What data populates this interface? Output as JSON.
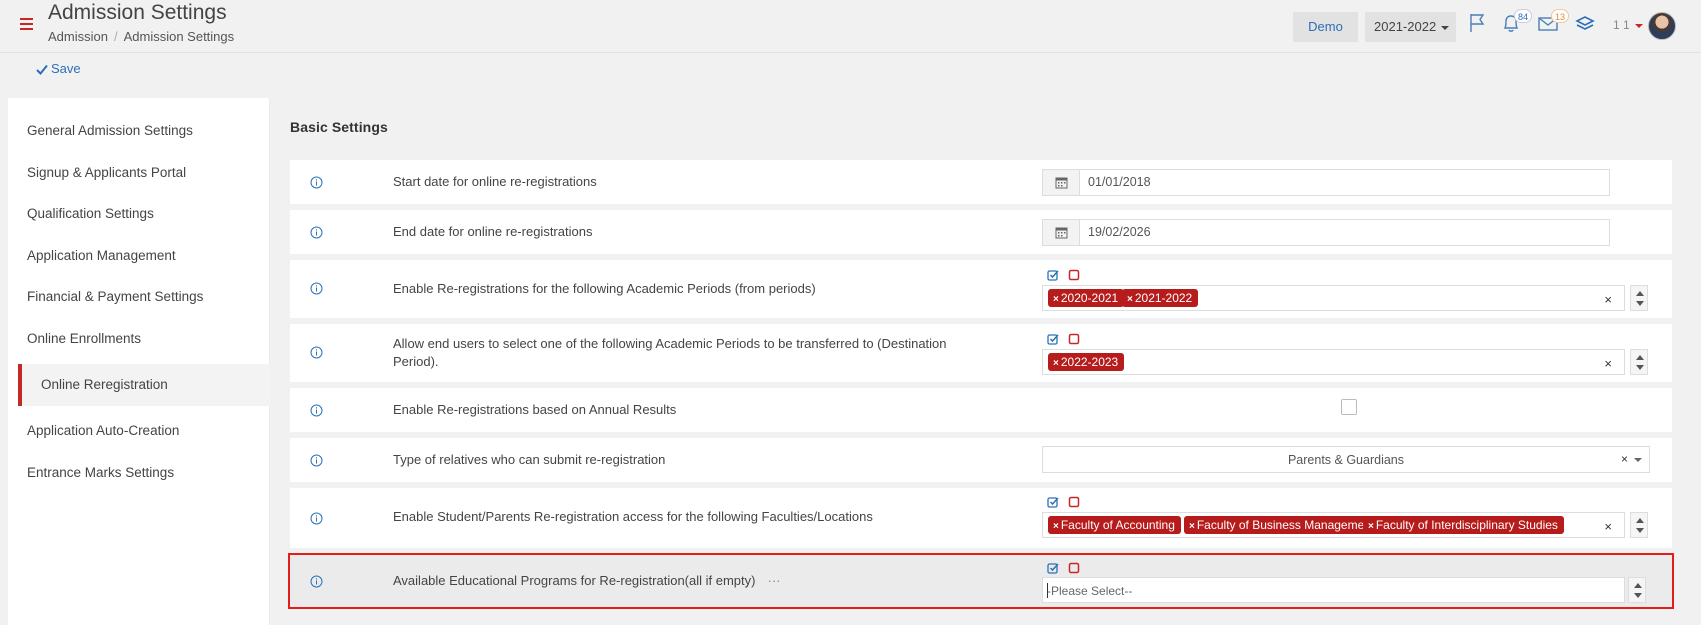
{
  "header": {
    "title": "Admission Settings",
    "breadcrumb": [
      "Admission",
      "Admission Settings"
    ],
    "demo_label": "Demo",
    "year_label": "2021-2022",
    "notifications_count": "84",
    "messages_count": "13",
    "user_label": "1 1"
  },
  "toolbar": {
    "save_label": "Save"
  },
  "sidebar": {
    "items": [
      {
        "label": "General Admission Settings"
      },
      {
        "label": "Signup & Applicants Portal"
      },
      {
        "label": "Qualification Settings"
      },
      {
        "label": "Application Management"
      },
      {
        "label": "Financial & Payment Settings"
      },
      {
        "label": "Online Enrollments"
      },
      {
        "label": "Online Reregistration"
      },
      {
        "label": "Application Auto-Creation"
      },
      {
        "label": "Entrance Marks Settings"
      }
    ],
    "active": "Online Reregistration"
  },
  "main": {
    "section_title": "Basic Settings",
    "rows": [
      {
        "label": "Start date for online re-registrations",
        "value": "01/01/2018"
      },
      {
        "label": "End date for online re-registrations",
        "value": "19/02/2026"
      },
      {
        "label": "Enable Re-registrations for the following Academic Periods (from periods)",
        "tags": [
          "2020-2021",
          "2021-2022"
        ]
      },
      {
        "label": "Allow end users to select one of the following Academic Periods to be transferred to (Destination Period).",
        "tags": [
          "2022-2023"
        ]
      },
      {
        "label": "Enable Re-registrations based on Annual Results",
        "checked": false
      },
      {
        "label": "Type of relatives who can submit re-registration",
        "value": "Parents & Guardians"
      },
      {
        "label": "Enable Student/Parents Re-registration access for the following Faculties/Locations",
        "tags": [
          "Faculty of Accounting",
          "Faculty of Business Management",
          "Faculty of Interdisciplinary Studies"
        ]
      },
      {
        "label": "Available Educational Programs for Re-registration(all if empty)",
        "ellipsis": "···",
        "placeholder": "-Please Select--"
      }
    ]
  },
  "colors": {
    "accent_red": "#b71c1c",
    "link_blue": "#2c6fb7",
    "highlight_border": "#e31c1c"
  }
}
